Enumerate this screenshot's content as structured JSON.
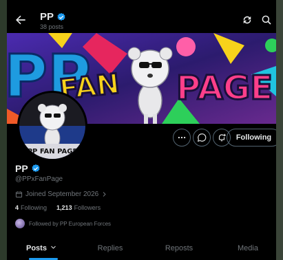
{
  "header": {
    "title": "PP",
    "post_count": "38 posts"
  },
  "banner": {
    "text_left": "PP",
    "text_fan": "FAN",
    "text_page": "PAGE"
  },
  "avatar": {
    "caption": "PP FAN PAGE"
  },
  "actions": {
    "following_label": "Following"
  },
  "profile": {
    "name": "PP",
    "handle": "@PPxFanPage",
    "joined": "Joined September 2026",
    "following_count": "4",
    "following_label": "Following",
    "followers_count": "1,213",
    "followers_label": "Followers",
    "followed_by": "Followed by PP European Forces"
  },
  "tabs": [
    {
      "label": "Posts"
    },
    {
      "label": "Replies"
    },
    {
      "label": "Reposts"
    },
    {
      "label": "Media"
    }
  ],
  "colors": {
    "accent": "#1d9bf0",
    "background": "#000000"
  }
}
